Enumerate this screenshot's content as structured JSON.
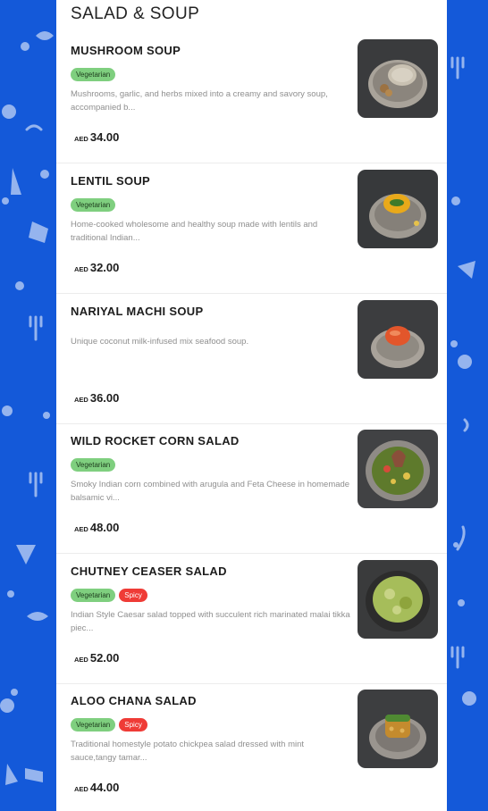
{
  "section": {
    "title": "SALAD & SOUP"
  },
  "menu": {
    "items": [
      {
        "name": "MUSHROOM SOUP",
        "tags": [
          {
            "label": "Vegetarian",
            "kind": "veg"
          }
        ],
        "description": "Mushrooms, garlic, and herbs mixed into a creamy and savory soup, accompanied b...",
        "currency": "AED",
        "price": "34.00",
        "image": {
          "subject": "mushroom-soup-photo",
          "bowl_color": "#a9a39a",
          "food_color": "#c9c1b2",
          "bg": "#3a3b3d"
        }
      },
      {
        "name": "LENTIL SOUP",
        "tags": [
          {
            "label": "Vegetarian",
            "kind": "veg"
          }
        ],
        "description": "Home-cooked wholesome and healthy soup made with lentils and traditional Indian...",
        "currency": "AED",
        "price": "32.00",
        "image": {
          "subject": "lentil-soup-photo",
          "bowl_color": "#9f9a92",
          "food_color": "#e9a91a",
          "bg": "#37393b"
        }
      },
      {
        "name": "NARIYAL MACHI SOUP",
        "tags": [],
        "description": "Unique coconut milk-infused mix seafood soup.",
        "currency": "AED",
        "price": "36.00",
        "image": {
          "subject": "nariyal-machi-soup-photo",
          "bowl_color": "#a8a29a",
          "food_color": "#e2562b",
          "bg": "#3c3d3f"
        }
      },
      {
        "name": "WILD ROCKET CORN SALAD",
        "tags": [
          {
            "label": "Vegetarian",
            "kind": "veg"
          }
        ],
        "description": "Smoky Indian corn combined with arugula and Feta Cheese in homemade balsamic vi...",
        "currency": "AED",
        "price": "48.00",
        "image": {
          "subject": "wild-rocket-corn-salad-photo",
          "bowl_color": "#8f8b86",
          "food_color": "#5e7a2c",
          "bg": "#414244"
        }
      },
      {
        "name": "CHUTNEY CEASER SALAD",
        "tags": [
          {
            "label": "Vegetarian",
            "kind": "veg"
          },
          {
            "label": "Spicy",
            "kind": "spicy"
          }
        ],
        "description": "Indian Style Caesar salad topped with succulent rich marinated malai tikka piec...",
        "currency": "AED",
        "price": "52.00",
        "image": {
          "subject": "chutney-ceaser-salad-photo",
          "bowl_color": "#2c2c2c",
          "food_color": "#a6bd5a",
          "bg": "#3a3b3c"
        }
      },
      {
        "name": "ALOO CHANA SALAD",
        "tags": [
          {
            "label": "Vegetarian",
            "kind": "veg"
          },
          {
            "label": "Spicy",
            "kind": "spicy"
          }
        ],
        "description": "Traditional homestyle potato chickpea salad dressed with mint sauce,tangy tamar...",
        "currency": "AED",
        "price": "44.00",
        "image": {
          "subject": "aloo-chana-salad-photo",
          "bowl_color": "#9a958f",
          "food_color": "#c48b2e",
          "bg": "#3d3e40"
        }
      }
    ]
  },
  "colors": {
    "background": "#1459d9",
    "panel": "#ffffff",
    "veg_tag": "#7fcf7f",
    "spicy_tag": "#ef3b36",
    "description_text": "#8f8f8f"
  }
}
